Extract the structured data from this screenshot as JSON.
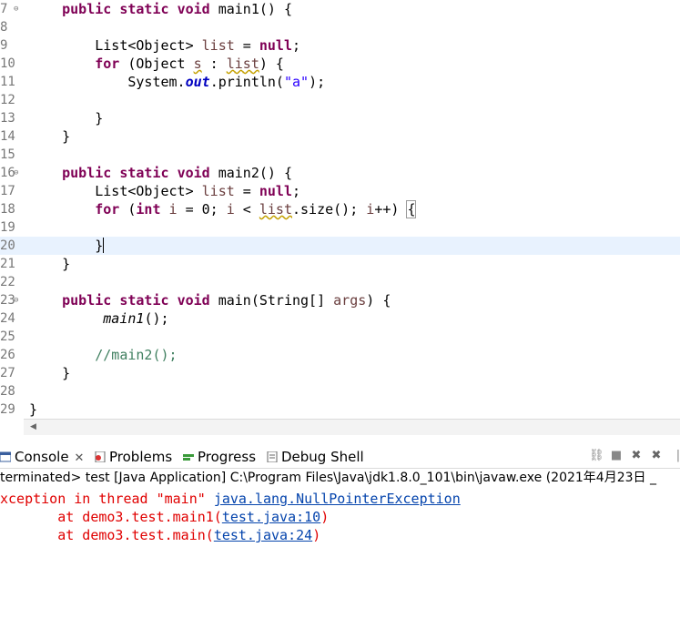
{
  "editor": {
    "lines": [
      {
        "num": "7",
        "fold": "⊖",
        "tokens": [
          {
            "t": "    "
          },
          {
            "t": "public",
            "c": "kw"
          },
          {
            "t": " "
          },
          {
            "t": "static",
            "c": "kw"
          },
          {
            "t": " "
          },
          {
            "t": "void",
            "c": "kw"
          },
          {
            "t": " main1() {"
          }
        ]
      },
      {
        "num": "8",
        "tokens": []
      },
      {
        "num": "9",
        "tokens": [
          {
            "t": "        List<Object> "
          },
          {
            "t": "list",
            "c": "var"
          },
          {
            "t": " = "
          },
          {
            "t": "null",
            "c": "kw"
          },
          {
            "t": ";"
          }
        ]
      },
      {
        "num": "10",
        "tokens": [
          {
            "t": "        "
          },
          {
            "t": "for",
            "c": "kw"
          },
          {
            "t": " (Object "
          },
          {
            "t": "s",
            "c": "var warn"
          },
          {
            "t": " : "
          },
          {
            "t": "list",
            "c": "var warn"
          },
          {
            "t": ") {"
          }
        ]
      },
      {
        "num": "11",
        "tokens": [
          {
            "t": "            System."
          },
          {
            "t": "out",
            "c": "fld"
          },
          {
            "t": ".println("
          },
          {
            "t": "\"a\"",
            "c": "str"
          },
          {
            "t": ");"
          }
        ]
      },
      {
        "num": "12",
        "tokens": []
      },
      {
        "num": "13",
        "tokens": [
          {
            "t": "        }"
          }
        ]
      },
      {
        "num": "14",
        "tokens": [
          {
            "t": "    }"
          }
        ]
      },
      {
        "num": "15",
        "tokens": []
      },
      {
        "num": "16",
        "fold": "⊖",
        "tokens": [
          {
            "t": "    "
          },
          {
            "t": "public",
            "c": "kw"
          },
          {
            "t": " "
          },
          {
            "t": "static",
            "c": "kw"
          },
          {
            "t": " "
          },
          {
            "t": "void",
            "c": "kw"
          },
          {
            "t": " main2() {"
          }
        ]
      },
      {
        "num": "17",
        "tokens": [
          {
            "t": "        List<Object> "
          },
          {
            "t": "list",
            "c": "var"
          },
          {
            "t": " = "
          },
          {
            "t": "null",
            "c": "kw"
          },
          {
            "t": ";"
          }
        ]
      },
      {
        "num": "18",
        "tokens": [
          {
            "t": "        "
          },
          {
            "t": "for",
            "c": "kw"
          },
          {
            "t": " ("
          },
          {
            "t": "int",
            "c": "kw"
          },
          {
            "t": " "
          },
          {
            "t": "i",
            "c": "var"
          },
          {
            "t": " = 0; "
          },
          {
            "t": "i",
            "c": "var"
          },
          {
            "t": " < "
          },
          {
            "t": "list",
            "c": "var warn"
          },
          {
            "t": ".size(); "
          },
          {
            "t": "i",
            "c": "var"
          },
          {
            "t": "++) "
          },
          {
            "t": "{",
            "c": "boxbrace"
          }
        ]
      },
      {
        "num": "19",
        "tokens": []
      },
      {
        "num": "20",
        "current": true,
        "tokens": [
          {
            "t": "        }"
          },
          {
            "t": "",
            "c": "caret"
          }
        ]
      },
      {
        "num": "21",
        "tokens": [
          {
            "t": "    }"
          }
        ]
      },
      {
        "num": "22",
        "tokens": []
      },
      {
        "num": "23",
        "fold": "⊖",
        "tokens": [
          {
            "t": "    "
          },
          {
            "t": "public",
            "c": "kw"
          },
          {
            "t": " "
          },
          {
            "t": "static",
            "c": "kw"
          },
          {
            "t": " "
          },
          {
            "t": "void",
            "c": "kw"
          },
          {
            "t": " main(String[] "
          },
          {
            "t": "args",
            "c": "var"
          },
          {
            "t": ") {"
          }
        ]
      },
      {
        "num": "24",
        "tokens": [
          {
            "t": "         "
          },
          {
            "t": "main1",
            "c": "itl"
          },
          {
            "t": "();"
          }
        ]
      },
      {
        "num": "25",
        "tokens": []
      },
      {
        "num": "26",
        "tokens": [
          {
            "t": "        "
          },
          {
            "t": "//main2();",
            "c": "cmt"
          }
        ]
      },
      {
        "num": "27",
        "tokens": [
          {
            "t": "    }"
          }
        ]
      },
      {
        "num": "28",
        "tokens": []
      },
      {
        "num": "29",
        "tokens": [
          {
            "t": "}"
          }
        ]
      }
    ]
  },
  "tabs": {
    "console": "Console",
    "console_close": "✕",
    "problems": "Problems",
    "progress": "Progress",
    "debug_shell": "Debug Shell"
  },
  "status_text": "terminated> test [Java Application] C:\\Program Files\\Java\\jdk1.8.0_101\\bin\\javaw.exe  (2021年4月23日 _",
  "console": {
    "line1_prefix": "xception in thread \"main\" ",
    "line1_link": "java.lang.NullPointerException",
    "line2_prefix": "       at demo3.test.main1(",
    "line2_link": "test.java:10",
    "line2_suffix": ")",
    "line3_prefix": "       at demo3.test.main(",
    "line3_link": "test.java:24",
    "line3_suffix": ")"
  },
  "colors": {
    "keyword": "#7f0055",
    "string": "#2a00ff",
    "comment": "#3f7f5f",
    "error": "#e00000",
    "link": "#0645ad",
    "current_line": "#e8f2fe"
  }
}
